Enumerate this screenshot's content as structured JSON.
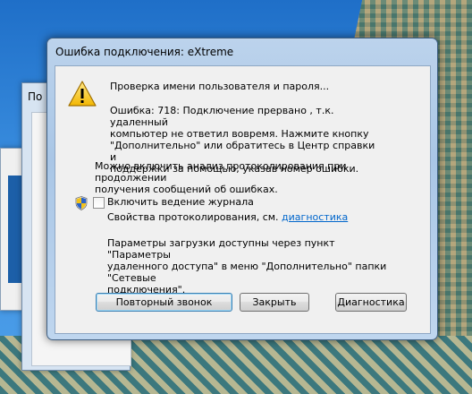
{
  "background": {
    "window1_title": "По",
    "window2_glyph": "↓"
  },
  "dialog": {
    "title": "Ошибка подключения: eXtreme",
    "checking_text": "Проверка имени пользователя и пароля...",
    "error_lines": [
      "Ошибка: 718: Подключение прервано , т.к.  удаленный",
      "компьютер не ответил вовремя. Нажмите кнопку",
      "\"Дополнительно\" или обратитесь в Центр справки и",
      "поддержки за помощью, указав номер ошибки."
    ],
    "protocol_lines": [
      "Можно включить анализ протоколирования при продолжении",
      "получения сообщений об ошибках."
    ],
    "checkbox_label": "Включить ведение журнала",
    "checkbox_checked": false,
    "props_prefix": "Свойства протоколирования, см. ",
    "props_link": "диагностика",
    "params_lines": [
      "Параметры загрузки доступны через пункт \"Параметры",
      "удаленного доступа\" в меню \"Дополнительно\" папки \"Сетевые",
      "подключения\"."
    ],
    "buttons": {
      "redial": "Повторный звонок",
      "close": "Закрыть",
      "diagnostics": "Диагностика"
    }
  },
  "icons": {
    "warning": "warning-icon",
    "shield": "uac-shield-icon"
  },
  "colors": {
    "link": "#0066cc",
    "frame": "#a9c6e6",
    "client": "#f0f0f0"
  }
}
